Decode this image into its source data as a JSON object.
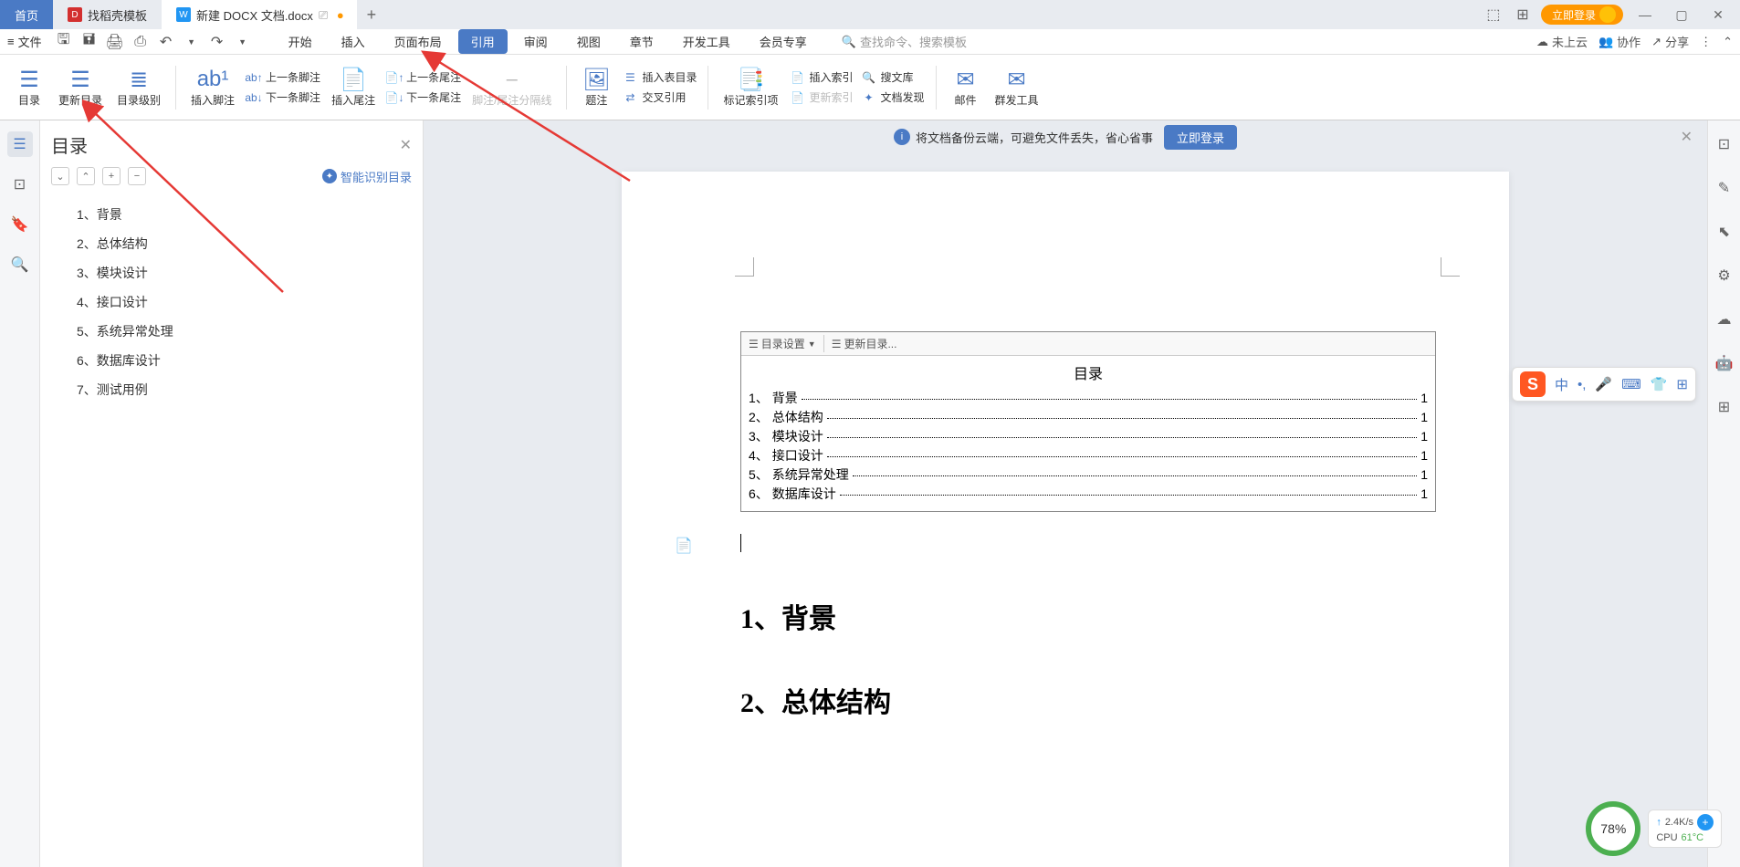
{
  "titlebar": {
    "tabs": [
      {
        "label": "首页",
        "type": "home"
      },
      {
        "label": "找稻壳模板",
        "type": "template"
      },
      {
        "label": "新建 DOCX 文档.docx",
        "type": "doc"
      }
    ],
    "login": "立即登录"
  },
  "menubar": {
    "file": "文件",
    "tabs": [
      "开始",
      "插入",
      "页面布局",
      "引用",
      "审阅",
      "视图",
      "章节",
      "开发工具",
      "会员专享"
    ],
    "active_tab": "引用",
    "search_placeholder": "查找命令、搜索模板",
    "right": {
      "cloud": "未上云",
      "collab": "协作",
      "share": "分享"
    }
  },
  "ribbon": {
    "toc": "目录",
    "update_toc": "更新目录",
    "toc_level": "目录级别",
    "insert_footnote": "插入脚注",
    "prev_footnote": "上一条脚注",
    "next_footnote": "下一条脚注",
    "insert_endnote": "插入尾注",
    "prev_endnote": "上一条尾注",
    "next_endnote": "下一条尾注",
    "separator": "脚注/尾注分隔线",
    "caption": "题注",
    "insert_fig_toc": "插入表目录",
    "cross_ref": "交叉引用",
    "mark_index": "标记索引项",
    "insert_index": "插入索引",
    "update_index": "更新索引",
    "search_docs": "搜文库",
    "doc_discover": "文档发现",
    "mail": "邮件",
    "mass_tools": "群发工具"
  },
  "outline": {
    "title": "目录",
    "smart": "智能识别目录",
    "items": [
      "1、背景",
      "2、总体结构",
      "3、模块设计",
      "4、接口设计",
      "5、系统异常处理",
      "6、数据库设计",
      "7、测试用例"
    ]
  },
  "cloudbar": {
    "text": "将文档备份云端，可避免文件丢失，省心省事",
    "login": "立即登录"
  },
  "doc": {
    "toc_toolbar": {
      "settings": "目录设置",
      "update": "更新目录..."
    },
    "toc_title": "目录",
    "toc_entries": [
      {
        "num": "1、",
        "text": "背景",
        "page": "1"
      },
      {
        "num": "2、",
        "text": "总体结构",
        "page": "1"
      },
      {
        "num": "3、",
        "text": "模块设计",
        "page": "1"
      },
      {
        "num": "4、",
        "text": "接口设计",
        "page": "1"
      },
      {
        "num": "5、",
        "text": "系统异常处理",
        "page": "1"
      },
      {
        "num": "6、",
        "text": "数据库设计",
        "page": "1"
      }
    ],
    "heading1": "1、背景",
    "heading2": "2、总体结构"
  },
  "ime": {
    "zh": "中"
  },
  "sysmon": {
    "pct": "78%",
    "net": "2.4K/s",
    "cpu_label": "CPU",
    "cpu_temp": "61°C"
  }
}
